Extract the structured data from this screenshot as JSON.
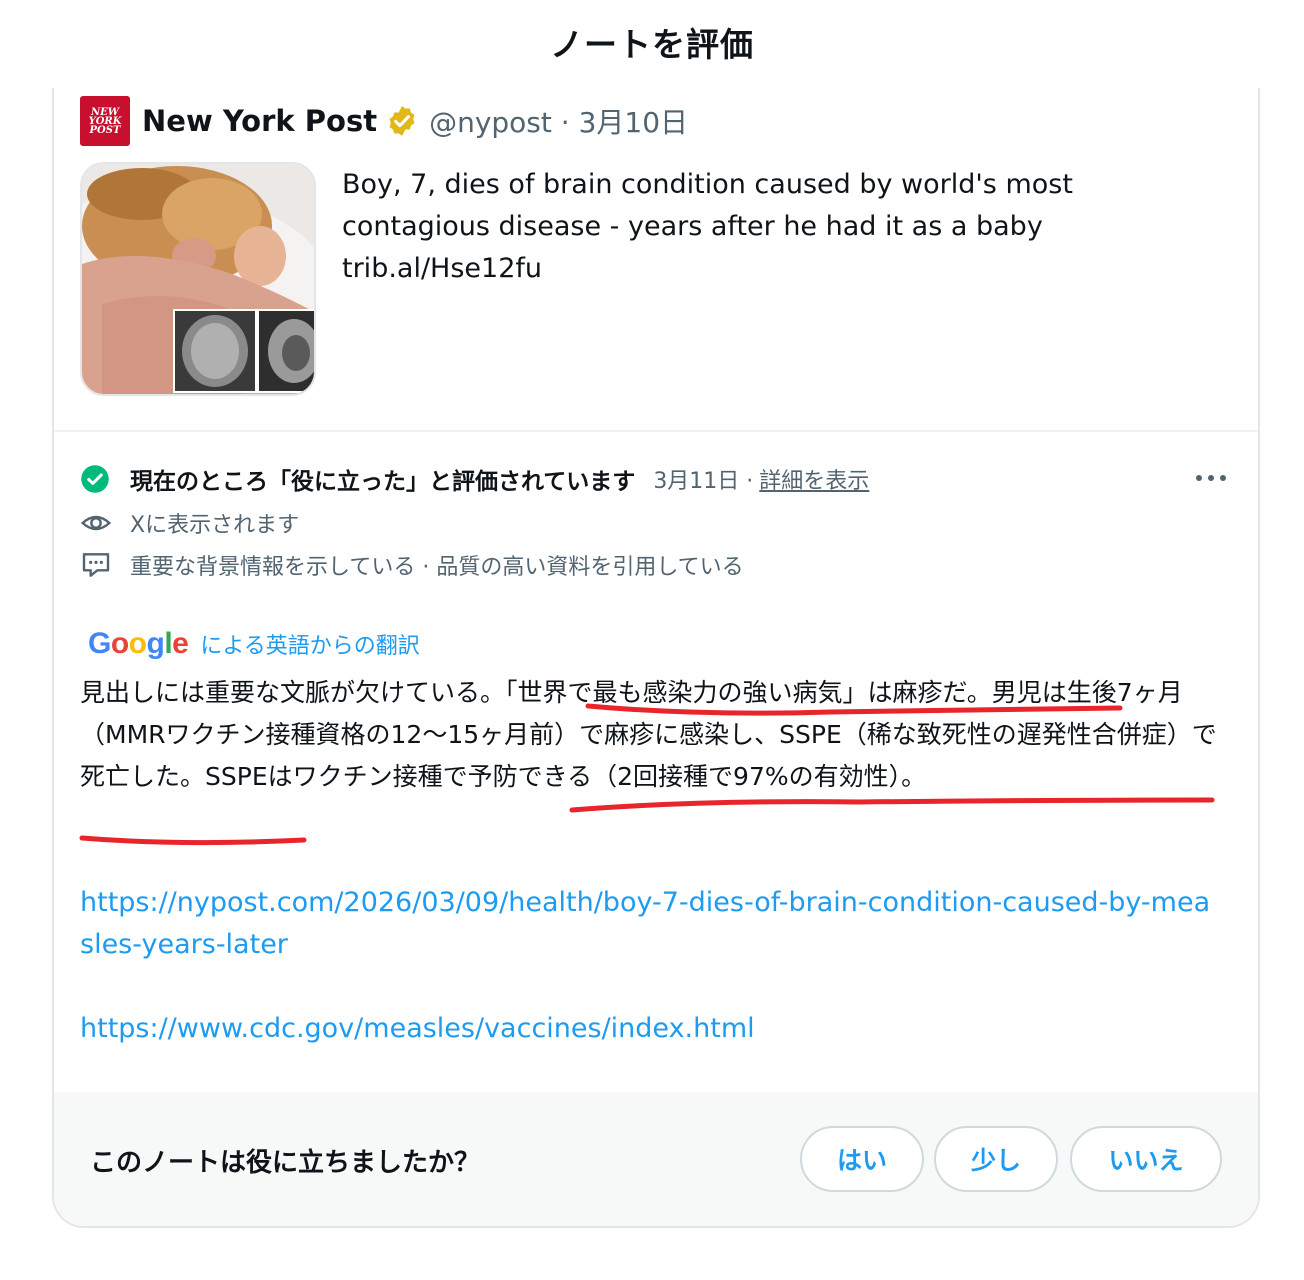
{
  "page": {
    "title": "ノートを評価"
  },
  "tweet": {
    "logo_text": "NEW YORK POST",
    "author": "New York Post",
    "handle_date": "@nypost · 3月10日",
    "text_line1": "Boy, 7, dies of brain condition caused by world's most",
    "text_line2": "contagious disease - years after he had it as a baby",
    "text_link": "trib.al/Hse12fu"
  },
  "note": {
    "status": "現在のところ「役に立った」と評価されています",
    "status_date": "3月11日 ·",
    "details_link": "詳細を表示",
    "visibility": "Xに表示されます",
    "reasons": "重要な背景情報を示している · 品質の高い資料を引用している",
    "translation_label": "による英語からの翻訳",
    "google": [
      "G",
      "o",
      "o",
      "g",
      "l",
      "e"
    ],
    "body_parts": [
      "見出しには重要な文脈が欠けている。",
      "「世界で最も感染力の強い病気」は麻疹だ",
      "。男児は生後7ヶ月（MMRワクチン接種資格の12〜15ヶ月前）で麻疹に感染し、SSPE（稀な致死性の遅発性合併症）で死亡した。",
      "SSPEはワクチン接種で予防できる（2回接種で97%の有効性）",
      "。"
    ],
    "link1": "https://nypost.com/2026/03/09/health/boy-7-dies-of-brain-condition-caused-by-measles-years-later",
    "link2": "https://www.cdc.gov/measles/vaccines/index.html"
  },
  "footer": {
    "question": "このノートは役に立ちましたか？",
    "yes": "はい",
    "somewhat": "少し",
    "no": "いいえ"
  },
  "colors": {
    "accent": "#1d9bf0",
    "check": "#00ba7c",
    "verified": "#e2b719",
    "annotation": "#e8252b",
    "nypost_red": "#c8102e"
  },
  "icons": [
    "verified-badge-icon",
    "check-circle-icon",
    "eye-icon",
    "comment-icon",
    "more-icon"
  ]
}
